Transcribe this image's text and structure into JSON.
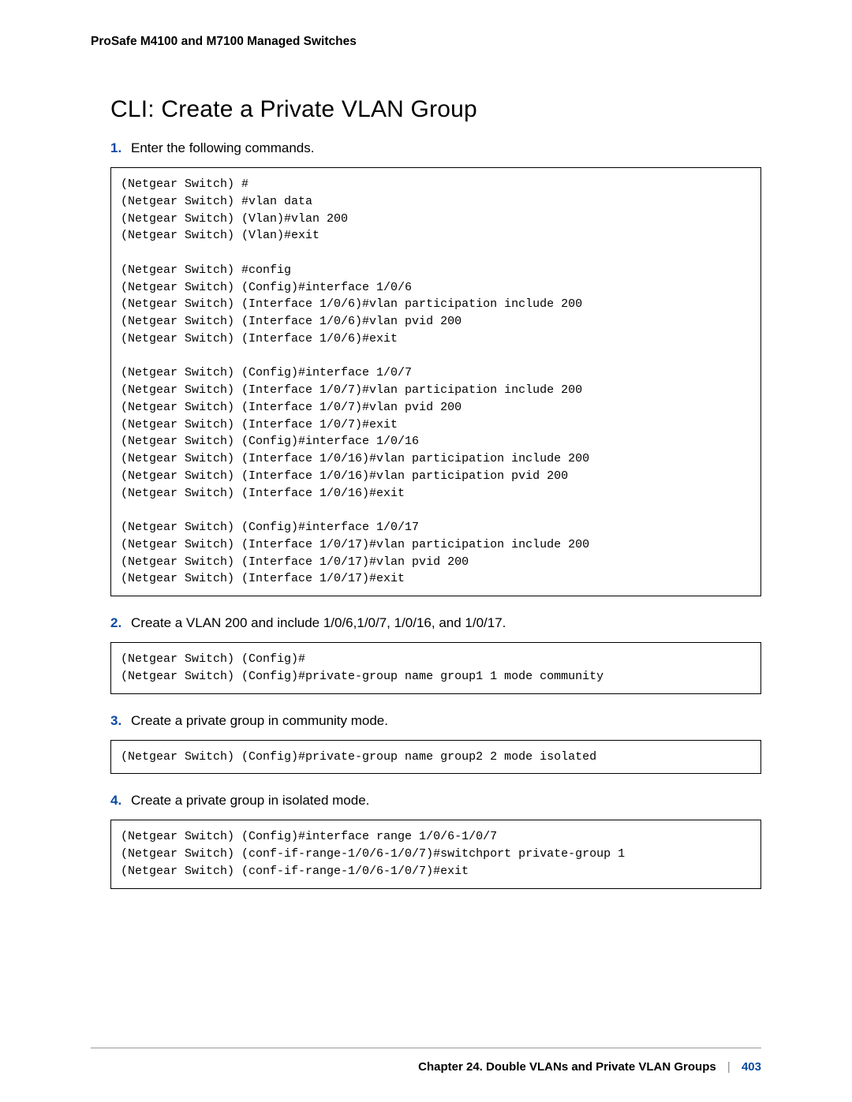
{
  "running_head": "ProSafe M4100 and M7100 Managed Switches",
  "section_title": "CLI: Create a Private VLAN Group",
  "steps": [
    {
      "num": "1.",
      "text": "Enter the following commands."
    },
    {
      "num": "2.",
      "text": "Create a VLAN 200 and include 1/0/6,1/0/7, 1/0/16, and 1/0/17."
    },
    {
      "num": "3.",
      "text": "Create a private group in community mode."
    },
    {
      "num": "4.",
      "text": "Create a private group in isolated mode."
    }
  ],
  "code_blocks": {
    "b1": "(Netgear Switch) #\n(Netgear Switch) #vlan data\n(Netgear Switch) (Vlan)#vlan 200\n(Netgear Switch) (Vlan)#exit\n\n(Netgear Switch) #config\n(Netgear Switch) (Config)#interface 1/0/6\n(Netgear Switch) (Interface 1/0/6)#vlan participation include 200\n(Netgear Switch) (Interface 1/0/6)#vlan pvid 200\n(Netgear Switch) (Interface 1/0/6)#exit\n\n(Netgear Switch) (Config)#interface 1/0/7\n(Netgear Switch) (Interface 1/0/7)#vlan participation include 200\n(Netgear Switch) (Interface 1/0/7)#vlan pvid 200\n(Netgear Switch) (Interface 1/0/7)#exit\n(Netgear Switch) (Config)#interface 1/0/16\n(Netgear Switch) (Interface 1/0/16)#vlan participation include 200\n(Netgear Switch) (Interface 1/0/16)#vlan participation pvid 200\n(Netgear Switch) (Interface 1/0/16)#exit\n\n(Netgear Switch) (Config)#interface 1/0/17\n(Netgear Switch) (Interface 1/0/17)#vlan participation include 200\n(Netgear Switch) (Interface 1/0/17)#vlan pvid 200\n(Netgear Switch) (Interface 1/0/17)#exit",
    "b2": "(Netgear Switch) (Config)#\n(Netgear Switch) (Config)#private-group name group1 1 mode community",
    "b3": "(Netgear Switch) (Config)#private-group name group2 2 mode isolated",
    "b4": "(Netgear Switch) (Config)#interface range 1/0/6-1/0/7\n(Netgear Switch) (conf-if-range-1/0/6-1/0/7)#switchport private-group 1\n(Netgear Switch) (conf-if-range-1/0/6-1/0/7)#exit"
  },
  "footer": {
    "chapter": "Chapter 24.  Double VLANs and Private VLAN Groups",
    "sep": "|",
    "page": "403"
  }
}
